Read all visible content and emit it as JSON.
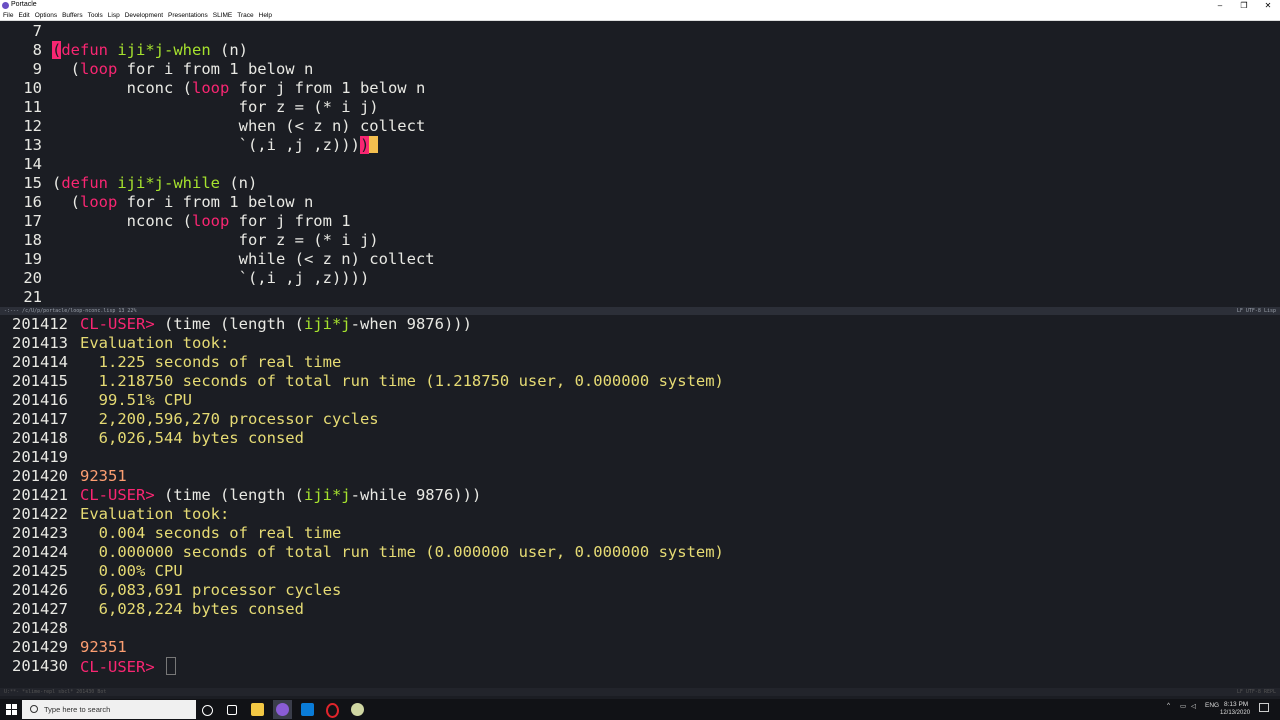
{
  "window": {
    "title": "Portacle",
    "controls": [
      "–",
      "❐",
      "✕"
    ]
  },
  "menu": [
    "File",
    "Edit",
    "Options",
    "Buffers",
    "Tools",
    "Lisp",
    "Development",
    "Presentations",
    "SLIME",
    "Trace",
    "Help"
  ],
  "editor": {
    "lines": [
      {
        "n": "7",
        "segs": []
      },
      {
        "n": "8",
        "segs": [
          {
            "t": "(",
            "c": "paren-hl"
          },
          {
            "t": "defun",
            "c": "kw"
          },
          {
            "t": " ",
            "c": ""
          },
          {
            "t": "iji*j-when",
            "c": "fn"
          },
          {
            "t": " (n)",
            "c": ""
          }
        ]
      },
      {
        "n": "9",
        "segs": [
          {
            "t": "  (",
            "c": ""
          },
          {
            "t": "loop",
            "c": "kw"
          },
          {
            "t": " for i from 1 below n",
            "c": ""
          }
        ]
      },
      {
        "n": "10",
        "segs": [
          {
            "t": "        nconc (",
            "c": ""
          },
          {
            "t": "loop",
            "c": "kw"
          },
          {
            "t": " for j from 1 below n",
            "c": ""
          }
        ]
      },
      {
        "n": "11",
        "segs": [
          {
            "t": "                    for z = (* i j)",
            "c": ""
          }
        ]
      },
      {
        "n": "12",
        "segs": [
          {
            "t": "                    when (< z n) collect",
            "c": ""
          }
        ]
      },
      {
        "n": "13",
        "segs": [
          {
            "t": "                    `(,i ,j ,z)))",
            "c": ""
          },
          {
            "t": ")",
            "c": "paren-hl2"
          },
          {
            "t": "",
            "c": "cursor"
          }
        ]
      },
      {
        "n": "14",
        "segs": []
      },
      {
        "n": "15",
        "segs": [
          {
            "t": "(",
            "c": ""
          },
          {
            "t": "defun",
            "c": "kw"
          },
          {
            "t": " ",
            "c": ""
          },
          {
            "t": "iji*j-while",
            "c": "fn"
          },
          {
            "t": " (n)",
            "c": ""
          }
        ]
      },
      {
        "n": "16",
        "segs": [
          {
            "t": "  (",
            "c": ""
          },
          {
            "t": "loop",
            "c": "kw"
          },
          {
            "t": " for i from 1 below n",
            "c": ""
          }
        ]
      },
      {
        "n": "17",
        "segs": [
          {
            "t": "        nconc (",
            "c": ""
          },
          {
            "t": "loop",
            "c": "kw"
          },
          {
            "t": " for j from 1",
            "c": ""
          }
        ]
      },
      {
        "n": "18",
        "segs": [
          {
            "t": "                    for z = (* i j)",
            "c": ""
          }
        ]
      },
      {
        "n": "19",
        "segs": [
          {
            "t": "                    while (< z n) collect",
            "c": ""
          }
        ]
      },
      {
        "n": "20",
        "segs": [
          {
            "t": "                    `(,i ,j ,z))))",
            "c": ""
          }
        ]
      },
      {
        "n": "21",
        "segs": []
      }
    ]
  },
  "modeline_top": {
    "left": "-:--- /c/U/p/portacle/loop-nconc.lisp   13 22%",
    "right": "LF UTF-8   Lisp"
  },
  "repl": {
    "lines": [
      {
        "n": "201412",
        "segs": [
          {
            "t": "CL-USER> ",
            "c": "prompt"
          },
          {
            "t": "(time (length (",
            "c": "plain"
          },
          {
            "t": "iji*j",
            "c": "green"
          },
          {
            "t": "-when 9876)))",
            "c": "plain"
          }
        ]
      },
      {
        "n": "201413",
        "segs": [
          {
            "t": "Evaluation took:",
            "c": "yellow"
          }
        ]
      },
      {
        "n": "201414",
        "segs": [
          {
            "t": "  1.225 seconds of real time",
            "c": "yellow"
          }
        ]
      },
      {
        "n": "201415",
        "segs": [
          {
            "t": "  1.218750 seconds of total run time (1.218750 user, 0.000000 system)",
            "c": "yellow"
          }
        ]
      },
      {
        "n": "201416",
        "segs": [
          {
            "t": "  99.51% CPU",
            "c": "yellow"
          }
        ]
      },
      {
        "n": "201417",
        "segs": [
          {
            "t": "  2,200,596,270 processor cycles",
            "c": "yellow"
          }
        ]
      },
      {
        "n": "201418",
        "segs": [
          {
            "t": "  6,026,544 bytes consed",
            "c": "yellow"
          }
        ]
      },
      {
        "n": "201419",
        "segs": []
      },
      {
        "n": "201420",
        "segs": [
          {
            "t": "92351",
            "c": "result"
          }
        ]
      },
      {
        "n": "201421",
        "segs": [
          {
            "t": "CL-USER> ",
            "c": "prompt"
          },
          {
            "t": "(time (length (",
            "c": "plain"
          },
          {
            "t": "iji*j",
            "c": "green"
          },
          {
            "t": "-while 9876)))",
            "c": "plain"
          }
        ]
      },
      {
        "n": "201422",
        "segs": [
          {
            "t": "Evaluation took:",
            "c": "yellow"
          }
        ]
      },
      {
        "n": "201423",
        "segs": [
          {
            "t": "  0.004 seconds of real time",
            "c": "yellow"
          }
        ]
      },
      {
        "n": "201424",
        "segs": [
          {
            "t": "  0.000000 seconds of total run time (0.000000 user, 0.000000 system)",
            "c": "yellow"
          }
        ]
      },
      {
        "n": "201425",
        "segs": [
          {
            "t": "  0.00% CPU",
            "c": "yellow"
          }
        ]
      },
      {
        "n": "201426",
        "segs": [
          {
            "t": "  6,083,691 processor cycles",
            "c": "yellow"
          }
        ]
      },
      {
        "n": "201427",
        "segs": [
          {
            "t": "  6,028,224 bytes consed",
            "c": "yellow"
          }
        ]
      },
      {
        "n": "201428",
        "segs": []
      },
      {
        "n": "201429",
        "segs": [
          {
            "t": "92351",
            "c": "result"
          }
        ]
      },
      {
        "n": "201430",
        "segs": [
          {
            "t": "CL-USER> ",
            "c": "prompt"
          },
          {
            "t": "",
            "c": "repl-cursor"
          }
        ]
      }
    ]
  },
  "modeline_bottom": {
    "left": "U:**- *slime-repl sbcl*   201430 Bot",
    "right": "LF UTF-8   REPL"
  },
  "taskbar": {
    "search_placeholder": "Type here to search",
    "time": "8:13 PM",
    "date": "12/13/2020",
    "lang": "ENG"
  },
  "colors": {
    "keyword": "#f92672",
    "function": "#a6e22e",
    "output": "#e6db74",
    "result": "#fd9f72",
    "background": "#1b1d23"
  }
}
